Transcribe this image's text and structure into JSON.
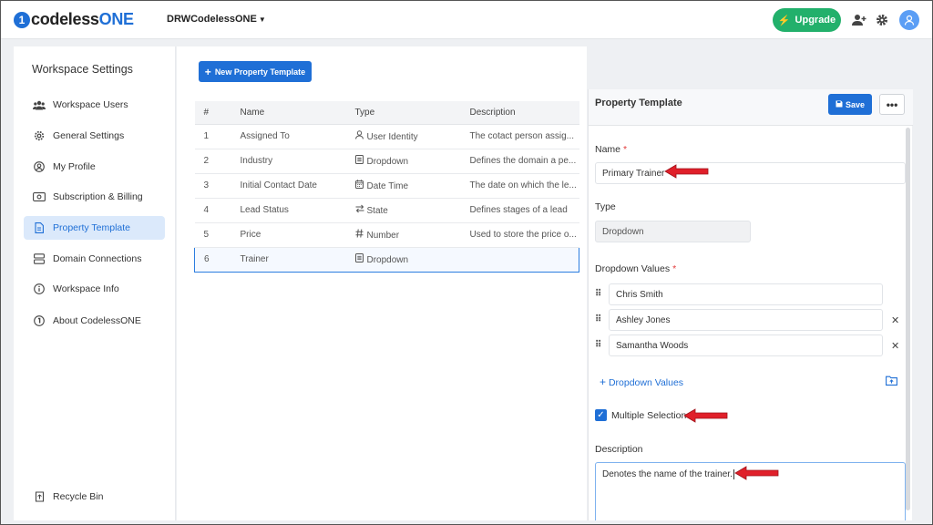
{
  "brand": {
    "name_prefix": "codeless",
    "name_suffix": "ONE",
    "mark": "1"
  },
  "workspace_switcher": {
    "label": "DRWCodelessONE"
  },
  "header": {
    "upgrade_label": "Upgrade"
  },
  "sidebar": {
    "title": "Workspace Settings",
    "items": [
      {
        "label": "Workspace Users",
        "icon": "users-icon"
      },
      {
        "label": "General Settings",
        "icon": "gear-icon"
      },
      {
        "label": "My Profile",
        "icon": "profile-icon"
      },
      {
        "label": "Subscription & Billing",
        "icon": "billing-icon"
      },
      {
        "label": "Property Template",
        "icon": "document-icon",
        "active": true
      },
      {
        "label": "Domain Connections",
        "icon": "server-icon"
      },
      {
        "label": "Workspace Info",
        "icon": "info-icon"
      },
      {
        "label": "About CodelessONE",
        "icon": "brand-icon"
      }
    ],
    "recycle_bin_label": "Recycle Bin"
  },
  "main": {
    "new_button_label": "New Property Template",
    "columns": [
      "#",
      "Name",
      "Type",
      "Description"
    ],
    "rows": [
      {
        "num": "1",
        "name": "Assigned To",
        "type": "User Identity",
        "type_icon": "user-icon",
        "description": "The cotact person assig..."
      },
      {
        "num": "2",
        "name": "Industry",
        "type": "Dropdown",
        "type_icon": "list-icon",
        "description": "Defines the domain a pe..."
      },
      {
        "num": "3",
        "name": "Initial Contact Date",
        "type": "Date Time",
        "type_icon": "calendar-icon",
        "description": "The date on which the le..."
      },
      {
        "num": "4",
        "name": "Lead Status",
        "type": "State",
        "type_icon": "state-icon",
        "description": "Defines stages of a lead"
      },
      {
        "num": "5",
        "name": "Price",
        "type": "Number",
        "type_icon": "hash-icon",
        "description": "Used to store the price o..."
      },
      {
        "num": "6",
        "name": "Trainer",
        "type": "Dropdown",
        "type_icon": "list-icon",
        "description": "",
        "selected": true
      }
    ]
  },
  "panel": {
    "title": "Property Template",
    "save_label": "Save",
    "name_label": "Name",
    "name_value": "Primary Trainer",
    "type_label": "Type",
    "type_value": "Dropdown",
    "dropdown_values_label": "Dropdown Values",
    "dropdown_values": [
      "Chris Smith",
      "Ashley Jones",
      "Samantha Woods"
    ],
    "add_values_label": "Dropdown Values",
    "multiple_selection_label": "Multiple Selection",
    "multiple_selection_checked": true,
    "description_label": "Description",
    "description_value": "Denotes the name of the trainer."
  },
  "colors": {
    "accent": "#1f6fd6",
    "upgrade": "#22b06b",
    "annotation_arrow": "#e0202a"
  }
}
